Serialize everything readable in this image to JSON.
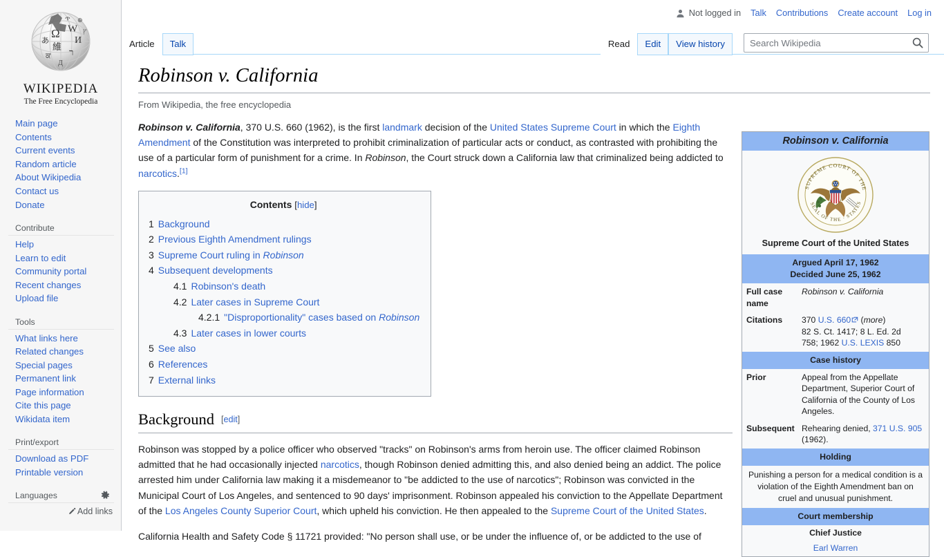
{
  "personal_bar": {
    "not_logged_in": "Not logged in",
    "links": [
      "Talk",
      "Contributions",
      "Create account",
      "Log in"
    ],
    "user_icon": "user-icon"
  },
  "sidebar": {
    "logo": {
      "wordmark": "WIKIPEDIA",
      "tagline": "The Free Encyclopedia",
      "globe_icon": "wikipedia-globe-logo"
    },
    "portals": [
      {
        "heading": "",
        "items": [
          "Main page",
          "Contents",
          "Current events",
          "Random article",
          "About Wikipedia",
          "Contact us",
          "Donate"
        ]
      },
      {
        "heading": "Contribute",
        "items": [
          "Help",
          "Learn to edit",
          "Community portal",
          "Recent changes",
          "Upload file"
        ]
      },
      {
        "heading": "Tools",
        "items": [
          "What links here",
          "Related changes",
          "Special pages",
          "Permanent link",
          "Page information",
          "Cite this page",
          "Wikidata item"
        ]
      },
      {
        "heading": "Print/export",
        "items": [
          "Download as PDF",
          "Printable version"
        ]
      }
    ],
    "languages": {
      "heading": "Languages",
      "gear_icon": "gear-icon",
      "add_links": "Add links",
      "pencil_icon": "pencil-icon"
    }
  },
  "namespace_tabs": [
    {
      "label": "Article",
      "selected": true
    },
    {
      "label": "Talk",
      "selected": false
    }
  ],
  "view_tabs": [
    {
      "label": "Read",
      "selected": true
    },
    {
      "label": "Edit",
      "selected": false
    },
    {
      "label": "View history",
      "selected": false
    }
  ],
  "search": {
    "placeholder": "Search Wikipedia",
    "value": "",
    "icon": "search-icon"
  },
  "article": {
    "title": "Robinson v. California",
    "site_sub": "From Wikipedia, the free encyclopedia",
    "lead": {
      "bold_title": "Robinson v. California",
      "p1_a": ", 370 U.S. 660 (1962), is the first ",
      "link_landmark": "landmark",
      "p1_b": " decision of the ",
      "link_scotus": "United States Supreme Court",
      "p1_c": " in which the ",
      "link_eighth": "Eighth Amendment",
      "p1_d": " of the Constitution was interpreted to prohibit criminalization of particular acts or conduct, as contrasted with prohibiting the use of a particular form of punishment for a crime. In ",
      "italic_robinson": "Robinson",
      "p1_e": ", the Court struck down a California law that criminalized being addicted to ",
      "link_narcotics": "narcotics",
      "p1_f": ".",
      "ref1": "[1]"
    }
  },
  "toc": {
    "title": "Contents",
    "toggle_open": "[",
    "toggle_label": "hide",
    "toggle_close": "]",
    "entries": [
      {
        "number": "1",
        "text": "Background",
        "level": 1,
        "italic_tail": ""
      },
      {
        "number": "2",
        "text": "Previous Eighth Amendment rulings",
        "level": 1,
        "italic_tail": ""
      },
      {
        "number": "3",
        "text": "Supreme Court ruling in ",
        "level": 1,
        "italic_tail": "Robinson"
      },
      {
        "number": "4",
        "text": "Subsequent developments",
        "level": 1,
        "italic_tail": ""
      },
      {
        "number": "4.1",
        "text": "Robinson's death",
        "level": 2,
        "italic_tail": ""
      },
      {
        "number": "4.2",
        "text": "Later cases in Supreme Court",
        "level": 2,
        "italic_tail": ""
      },
      {
        "number": "4.2.1",
        "text": "\"Disproportionality\" cases based on ",
        "level": 3,
        "italic_tail": "Robinson"
      },
      {
        "number": "4.3",
        "text": "Later cases in lower courts",
        "level": 2,
        "italic_tail": ""
      },
      {
        "number": "5",
        "text": "See also",
        "level": 1,
        "italic_tail": ""
      },
      {
        "number": "6",
        "text": "References",
        "level": 1,
        "italic_tail": ""
      },
      {
        "number": "7",
        "text": "External links",
        "level": 1,
        "italic_tail": ""
      }
    ]
  },
  "background_section": {
    "heading": "Background",
    "edit_open": "[",
    "edit_label": "edit",
    "edit_close": "]",
    "p1_a": "Robinson was stopped by a police officer who observed \"tracks\" on Robinson's arms from heroin use. The officer claimed Robinson admitted that he had occasionally injected ",
    "link_narcotics": "narcotics",
    "p1_b": ", though Robinson denied admitting this, and also denied being an addict. The police arrested him under California law making it a misdemeanor to \"be addicted to the use of narcotics\"; Robinson was convicted in the Municipal Court of Los Angeles, and sentenced to 90 days' imprisonment. Robinson appealed his conviction to the Appellate Department of the ",
    "link_la_court": "Los Angeles County Superior Court",
    "p1_c": ", which upheld his conviction. He then appealed to the ",
    "link_scotus": "Supreme Court of the United States",
    "p1_d": ".",
    "p2": "California Health and Safety Code § 11721 provided: \"No person shall use, or be under the influence of, or be addicted to the use of"
  },
  "infobox": {
    "title": "Robinson v. California",
    "seal_icon": "supreme-court-seal",
    "caption": "Supreme Court of the United States",
    "argued": "Argued April 17, 1962",
    "decided": "Decided June 25, 1962",
    "rows": [
      {
        "label": "Full case name",
        "value": "Robinson v. California",
        "italic": true
      }
    ],
    "citations_label": "Citations",
    "citations": {
      "line1_a": "370 ",
      "line1_link": "U.S. 660",
      "line1_icon": "external-link-icon",
      "line1_more_open": " (",
      "line1_more": "more",
      "line1_more_close": ")",
      "line2": "82 S. Ct. 1417; 8 L. Ed. 2d",
      "line3_a": "758; 1962 ",
      "line3_link": "U.S. LEXIS",
      "line3_b": " 850"
    },
    "case_history_header": "Case history",
    "prior_label": "Prior",
    "prior_value": "Appeal from the Appellate Department, Superior Court of California of the County of Los Angeles.",
    "subsequent_label": "Subsequent",
    "subsequent_a": "Rehearing denied, ",
    "subsequent_link": "371 U.S. 905",
    "subsequent_b": " (1962).",
    "holding_header": "Holding",
    "holding_text": "Punishing a person for a medical condition is a violation of the Eighth Amendment ban on cruel and unusual punishment.",
    "court_membership_header": "Court membership",
    "chief_justice_label": "Chief Justice",
    "chief_justice_name": "Earl Warren"
  },
  "colors": {
    "link": "#3366cc",
    "infobox_header_blue": "#8fb6f2",
    "sidebar_bg": "#f6f6f6",
    "toc_bg": "#f8f9fa",
    "rule": "#a2a9b1",
    "tab_border": "#a7d7f9"
  }
}
